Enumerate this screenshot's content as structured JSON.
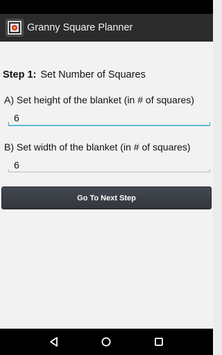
{
  "app": {
    "title": "Granny Square Planner"
  },
  "step": {
    "label": "Step 1:",
    "title": "Set Number of Squares"
  },
  "height_field": {
    "label": "A) Set height of the blanket (in # of squares)",
    "value": "6"
  },
  "width_field": {
    "label": "B) Set width of the blanket (in # of squares)",
    "value": "6"
  },
  "next_button": {
    "label": "Go To Next Step"
  },
  "nav": {
    "back_icon": "back-icon",
    "home_icon": "home-icon",
    "recents_icon": "recents-icon"
  },
  "colors": {
    "action_bar": "#2b2b2b",
    "focused_underline": "#33a6cc",
    "unfocused_underline": "#b8b8b8",
    "button": "#3a3e44"
  }
}
